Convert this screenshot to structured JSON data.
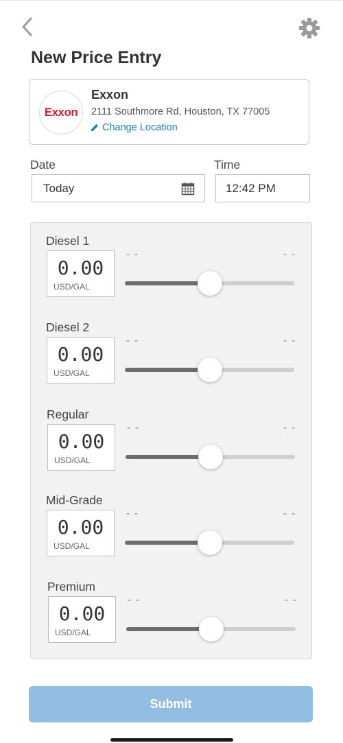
{
  "header": {
    "title": "New Price Entry",
    "back_icon": "chevron-left-icon",
    "settings_icon": "gear-icon"
  },
  "station": {
    "logo_text": "Exxon",
    "name": "Exxon",
    "address": "2111 Southmore Rd, Houston, TX 77005",
    "change_location_label": "Change Location",
    "change_location_icon": "pencil-icon",
    "logo_color": "#d3202f",
    "link_color": "#1c7fc0"
  },
  "date": {
    "label": "Date",
    "value": "Today",
    "icon": "calendar-icon"
  },
  "time": {
    "label": "Time",
    "value": "12:42 PM"
  },
  "fuels": [
    {
      "name": "Diesel 1",
      "price": "0.00",
      "unit": "USD/GAL",
      "range_min": "--",
      "range_max": "--",
      "slider_level": 0.5
    },
    {
      "name": "Diesel 2",
      "price": "0.00",
      "unit": "USD/GAL",
      "range_min": "--",
      "range_max": "--",
      "slider_level": 0.5
    },
    {
      "name": "Regular",
      "price": "0.00",
      "unit": "USD/GAL",
      "range_min": "--",
      "range_max": "--",
      "slider_level": 0.5
    },
    {
      "name": "Mid-Grade",
      "price": "0.00",
      "unit": "USD/GAL",
      "range_min": "--",
      "range_max": "--",
      "slider_level": 0.5
    },
    {
      "name": "Premium",
      "price": "0.00",
      "unit": "USD/GAL",
      "range_min": "--",
      "range_max": "--",
      "slider_level": 0.5
    }
  ],
  "submit": {
    "label": "Submit",
    "color": "#91bde3"
  }
}
